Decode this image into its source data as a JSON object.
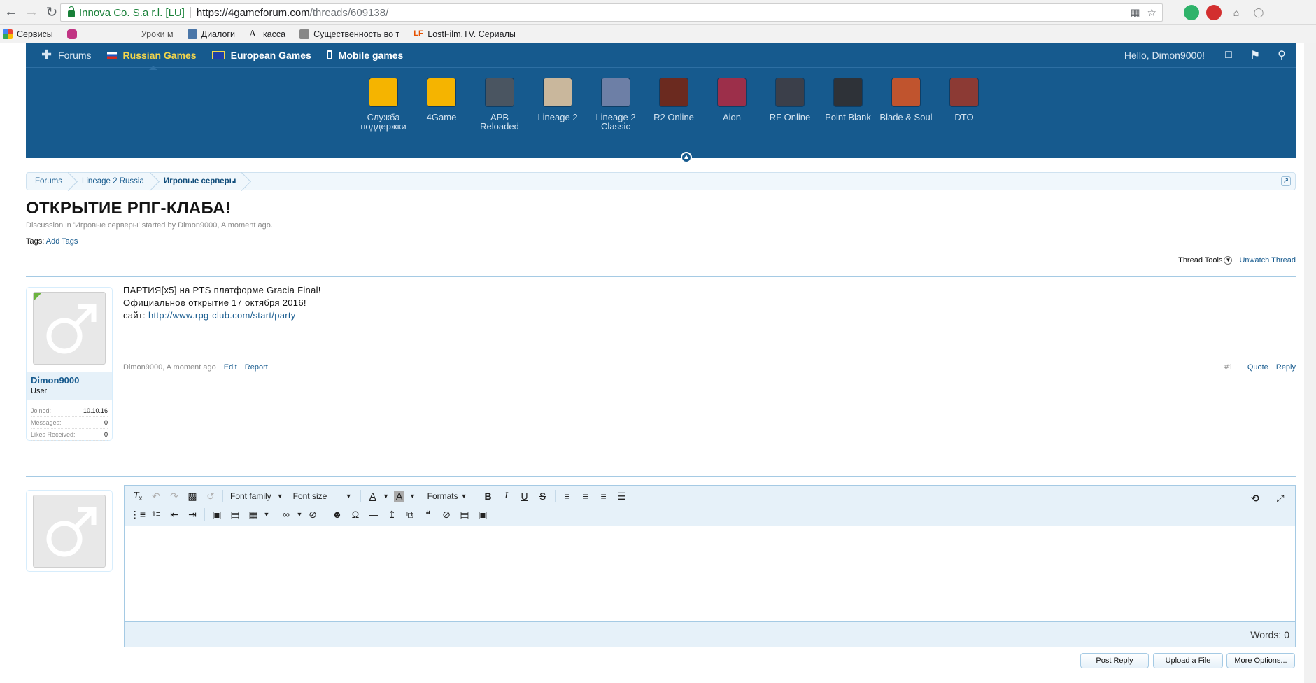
{
  "browser": {
    "cert_label": "Innova Co. S.a r.l. [LU]",
    "url_scheme_host": "https://4gameforum.com",
    "url_path": "/threads/609138/",
    "bookmarks": [
      "Сервисы",
      "Уроки м",
      "Диалоги",
      "касса",
      "Существенность во т",
      "LostFilm.TV. Сериалы"
    ]
  },
  "topnav": {
    "forums": "Forums",
    "russian": "Russian Games",
    "european": "European Games",
    "mobile": "Mobile games",
    "hello": "Hello, Dimon9000!"
  },
  "games": [
    {
      "label": "Служба поддержки",
      "color": "#f5b400"
    },
    {
      "label": "4Game",
      "color": "#f5b400"
    },
    {
      "label": "APB Reloaded",
      "color": "#4a5561"
    },
    {
      "label": "Lineage 2",
      "color": "#c9b79c"
    },
    {
      "label": "Lineage 2 Classic",
      "color": "#6d7fa6"
    },
    {
      "label": "R2 Online",
      "color": "#6b2a1f"
    },
    {
      "label": "Aion",
      "color": "#9c2f4a"
    },
    {
      "label": "RF Online",
      "color": "#3b3f4a"
    },
    {
      "label": "Point Blank",
      "color": "#2e3238"
    },
    {
      "label": "Blade & Soul",
      "color": "#c0542e"
    },
    {
      "label": "DTO",
      "color": "#8c3a34"
    }
  ],
  "breadcrumb": [
    "Forums",
    "Lineage 2 Russia",
    "Игровые серверы"
  ],
  "thread": {
    "title": "ОТКРЫТИЕ РПГ-КЛАБА!",
    "meta": "Discussion in 'Игровые серверы' started by Dimon9000, A moment ago.",
    "tags_label": "Tags:",
    "tags_link": "Add Tags",
    "thread_tools": "Thread Tools",
    "unwatch": "Unwatch Thread"
  },
  "post": {
    "line1": "ПАРТИЯ[x5] на PTS платформе Gracia Final!",
    "line2": "Официальное открытие 17 октября 2016!",
    "line3_label": "сайт: ",
    "line3_link": "http://www.rpg-club.com/start/party",
    "author_time": "Dimon9000, A moment ago",
    "edit": "Edit",
    "report": "Report",
    "number": "#1",
    "quote": "+ Quote",
    "reply": "Reply"
  },
  "user": {
    "name": "Dimon9000",
    "title": "User",
    "stats": [
      {
        "label": "Joined:",
        "value": "10.10.16"
      },
      {
        "label": "Messages:",
        "value": "0"
      },
      {
        "label": "Likes Received:",
        "value": "0"
      }
    ]
  },
  "editor": {
    "font_family": "Font family",
    "font_size": "Font size",
    "formats": "Formats",
    "words": "Words: 0"
  },
  "buttons": {
    "post_reply": "Post Reply",
    "upload": "Upload a File",
    "more": "More Options..."
  }
}
